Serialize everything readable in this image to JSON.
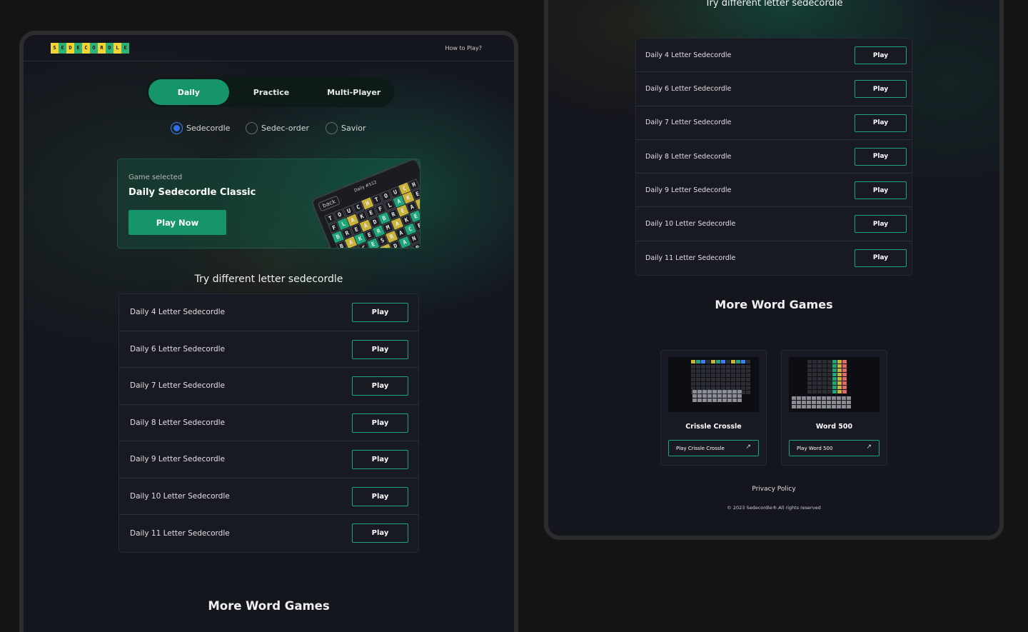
{
  "nav": {
    "logo_letters": [
      "S",
      "E",
      "D",
      "E",
      "C",
      "O",
      "R",
      "D",
      "L",
      "E"
    ],
    "logo_colors": [
      "#f2d533",
      "#2db37a",
      "#f2d533",
      "#2db37a",
      "#f2d533",
      "#2db37a",
      "#f2d533",
      "#2db37a",
      "#f2d533",
      "#2db37a"
    ],
    "how_to_play": "How to Play?"
  },
  "tabs": [
    {
      "label": "Daily",
      "active": true
    },
    {
      "label": "Practice",
      "active": false
    },
    {
      "label": "Multi-Player",
      "active": false
    }
  ],
  "game_modes": [
    {
      "label": "Sedecordle",
      "checked": true
    },
    {
      "label": "Sedec-order",
      "checked": false
    },
    {
      "label": "Savior",
      "checked": false
    }
  ],
  "selected_game": {
    "caption": "Game selected",
    "title": "Daily Sedecordle Classic",
    "play_label": "Play Now",
    "illustration": {
      "back_label": "back",
      "daily_number": "Daily #512",
      "rows": [
        [
          "T",
          "O",
          "U",
          "C",
          "H",
          "T",
          "O",
          "U",
          "C",
          "H"
        ],
        [
          "F",
          "L",
          "A",
          "K",
          "E",
          "F",
          "L",
          "A",
          "K",
          "E"
        ],
        [
          "B",
          "R",
          "E",
          "A",
          "D",
          "B",
          "R",
          "E",
          "A",
          "K"
        ],
        [
          "B",
          "A",
          "K",
          "E",
          "R",
          "M",
          "A",
          "K",
          "E",
          "R"
        ],
        [
          "M",
          "A",
          "C",
          "E",
          "S",
          "R",
          "A",
          "C",
          "E",
          "S"
        ],
        [
          "R",
          "A",
          "N",
          "C",
          "E",
          "D",
          "A",
          "N",
          "C",
          "E"
        ],
        [
          "S",
          "O",
          "U",
          "R",
          "S",
          "O",
          "U",
          "R",
          "C",
          "E"
        ]
      ]
    }
  },
  "variants_section": {
    "title": "Try different letter sedecordle",
    "play_label": "Play",
    "items": [
      "Daily 4 Letter Sedecordle",
      "Daily 6 Letter Sedecordle",
      "Daily 7 Letter Sedecordle",
      "Daily 8 Letter Sedecordle",
      "Daily 9 Letter Sedecordle",
      "Daily 10 Letter Sedecordle",
      "Daily 11 Letter Sedecordle"
    ]
  },
  "more_games": {
    "title": "More Word Games",
    "games": [
      {
        "name": "Crissle Crossle",
        "link": "Play Crissle Crossle"
      },
      {
        "name": "Word 500",
        "link": "Play Word 500"
      }
    ]
  },
  "footer": {
    "privacy": "Privacy Policy",
    "copyright": "© 2023 Sedecordle®.All rights reserved"
  },
  "colors": {
    "accent": "#16946a",
    "accent_border": "#1fa57a",
    "radio_checked": "#2f6ee8",
    "background": "#14161d"
  }
}
